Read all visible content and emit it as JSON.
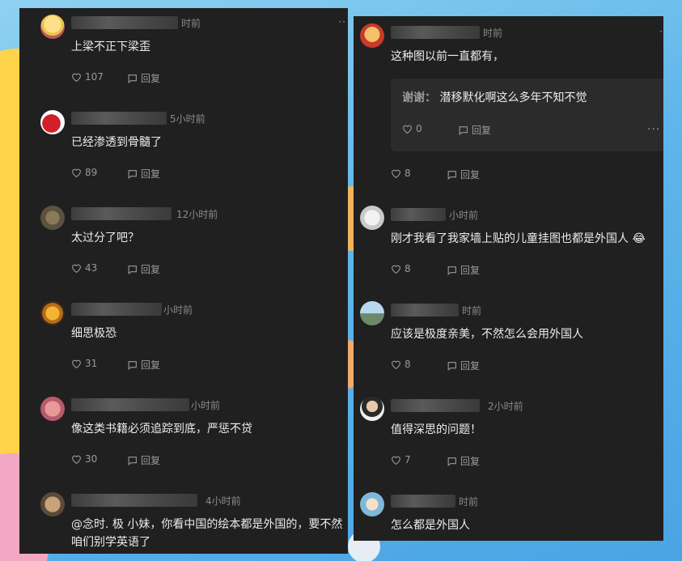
{
  "colors": {
    "panel_bg": "#202020",
    "text": "#ececec",
    "muted": "#8a8a8a",
    "page_bg": "#5fb6ea"
  },
  "icons": {
    "like": "heart-icon",
    "reply": "comment-bubble-icon",
    "more": "more-dots-icon"
  },
  "left_comments": [
    {
      "time": "时前",
      "text": "上梁不正下梁歪",
      "likes": "107",
      "reply": "回复"
    },
    {
      "time": "5小时前",
      "text": "已经渗透到骨髓了",
      "likes": "89",
      "reply": "回复"
    },
    {
      "time": "12小时前",
      "text": "太过分了吧？",
      "likes": "43",
      "reply": "回复"
    },
    {
      "time": "小时前",
      "text": "细思极恐",
      "likes": "31",
      "reply": "回复"
    },
    {
      "time": "小时前",
      "text": "像这类书籍必须追踪到底，严惩不贷",
      "likes": "30",
      "reply": "回复"
    },
    {
      "time": "4小时前",
      "text": "@念时. 极 小妹，你看中国的绘本都是外国的，要不然咱们别学英语了",
      "likes": "",
      "reply": ""
    }
  ],
  "right_comments": [
    {
      "time": "时前",
      "text": "这种图以前一直都有，",
      "reply_box": {
        "author": "谢谢：",
        "text": "潜移默化啊这么多年不知不觉",
        "likes": "0",
        "reply": "回复"
      },
      "likes": "8",
      "reply": "回复"
    },
    {
      "time": "小时前",
      "text": "刚才我看了我家墙上贴的儿童挂图也都是外国人 😂",
      "likes": "8",
      "reply": "回复"
    },
    {
      "time": "时前",
      "text": "应该是极度亲美，不然怎么会用外国人",
      "likes": "8",
      "reply": "回复"
    },
    {
      "time": "2小时前",
      "text": "值得深思的问题！",
      "likes": "7",
      "reply": "回复"
    },
    {
      "time": "时前",
      "text": "怎么都是外国人",
      "likes": "",
      "reply": ""
    }
  ]
}
